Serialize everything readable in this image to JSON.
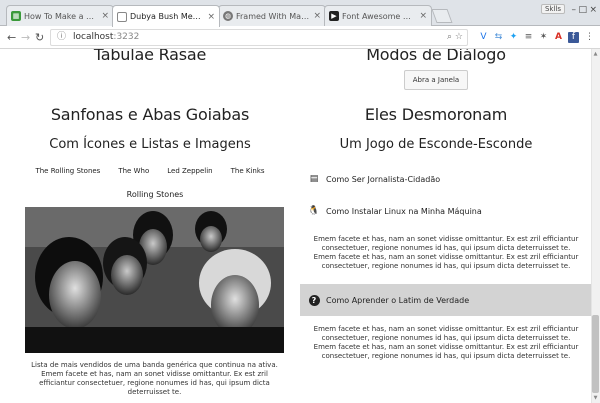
{
  "browser": {
    "tabs": [
      {
        "label": "How To Make a Model",
        "favicon_color": "#3a9a3a"
      },
      {
        "label": "Dubya Bush Memorie",
        "favicon_color": "#ffffff",
        "active": true
      },
      {
        "label": "Framed With Materi",
        "favicon_color": "#666666"
      },
      {
        "label": "Font Awesome Chea",
        "favicon_color": "#222222"
      }
    ],
    "profile": "Sklls",
    "url_host": "localhost",
    "url_port": ":3232"
  },
  "page": {
    "left": {
      "title1": "Tabulae Rasae",
      "title2": "Sanfonas e Abas Goiabas",
      "subtitle": "Com Ícones e Listas e Imagens",
      "tabs": [
        "The Rolling Stones",
        "The Who",
        "Led Zeppelin",
        "The Kinks"
      ],
      "panel_title": "Rolling Stones",
      "caption": "Lista de mais vendidos de uma banda genérica que continua na ativa. Emem facete et has, nam an sonet vidisse omittantur. Ex est zril efficiantur consectetuer, regione nonumes id has, qui ipsum dicta deterruisset te."
    },
    "right": {
      "title1": "Modos de Diálogo",
      "button": "Abra a Janela",
      "title2": "Eles Desmoronam",
      "subtitle": "Um Jogo de Esconde-Esconde",
      "accordion": [
        {
          "label": "Como Ser Jornalista-Cidadão",
          "icon": "newspaper-icon"
        },
        {
          "label": "Como Instalar Linux na Minha Máquina",
          "icon": "linux-icon",
          "body": "Emem facete et has, nam an sonet vidisse omittantur. Ex est zril efficiantur consectetuer, regione nonumes id has, qui ipsum dicta deterruisset te. Emem facete et has, nam an sonet vidisse omittantur. Ex est zril efficiantur consectetuer, regione nonumes id has, qui ipsum dicta deterruisset te."
        },
        {
          "label": "Como Aprender o Latim de Verdade",
          "icon": "question-circle-icon",
          "body": "Emem facete et has, nam an sonet vidisse omittantur. Ex est zril efficiantur consectetuer, regione nonumes id has, qui ipsum dicta deterruisset te. Emem facete et has, nam an sonet vidisse omittantur. Ex est zril efficiantur consectetuer, regione nonumes id has, qui ipsum dicta deterruisset te."
        }
      ]
    }
  }
}
